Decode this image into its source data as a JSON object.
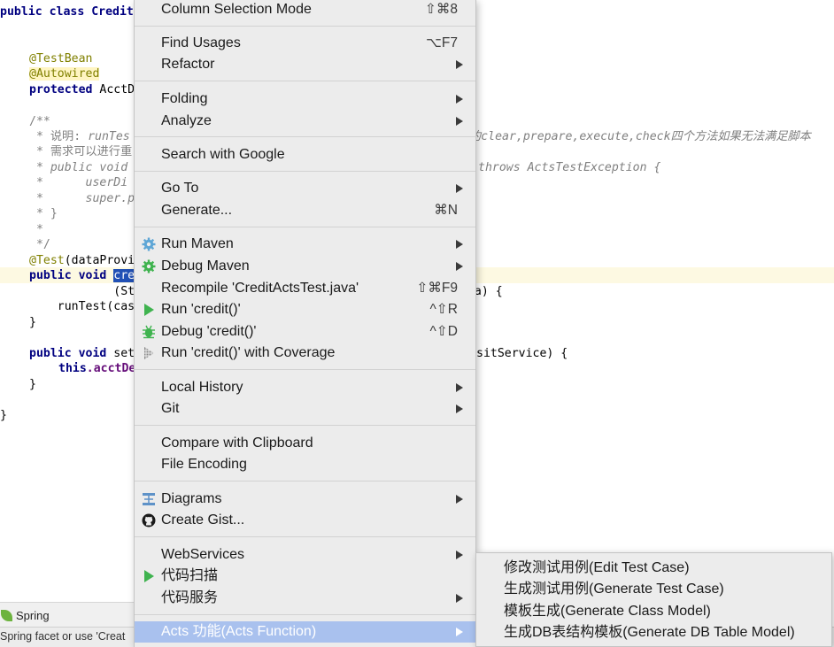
{
  "editor": {
    "lines": {
      "l0": "public class Credit",
      "l3": "@TestBean",
      "l4": "@Autowired",
      "l5_kw": "protected",
      "l5_rest": " AcctD",
      "l7": "/**",
      "l8_a": " * 说明: ",
      "l8_b": "runTes",
      "l8_right": "约clear,prepare,execute,check四个方法如果无法满足脚本",
      "l9": " * 需求可以进行重",
      "l10_a": " * public void",
      "l10_right": "throws ActsTestException {",
      "l11": " *      userDi",
      "l12": " *      super.p",
      "l13": " * }",
      "l14": " *",
      "l15": " */",
      "l16_ann": "@Test",
      "l16_rest": "(dataProvi",
      "l17_kw": "public void ",
      "l17_sel": "cre",
      "l18": "            (St",
      "l18_right": "ata) {",
      "l19": "    runTest(cas",
      "l20": "}",
      "l22_kw": "public void ",
      "l22_rest": "set",
      "l22_right": "sitService) {",
      "l23_kw": "this",
      "l23_rest": ".acctDe",
      "l24": "}",
      "l26": "}"
    }
  },
  "bottom": {
    "spring_tab": "Spring",
    "status": "Spring facet or use 'Creat"
  },
  "menu": {
    "column_selection": {
      "label": "Column Selection Mode",
      "shortcut": "⇧⌘8"
    },
    "find_usages": {
      "label": "Find Usages",
      "shortcut": "⌥F7"
    },
    "refactor": {
      "label": "Refactor"
    },
    "folding": {
      "label": "Folding"
    },
    "analyze": {
      "label": "Analyze"
    },
    "search_google": {
      "label": "Search with Google"
    },
    "go_to": {
      "label": "Go To"
    },
    "generate": {
      "label": "Generate...",
      "shortcut": "⌘N"
    },
    "run_maven": {
      "label": "Run Maven",
      "icon": "gear-icon"
    },
    "debug_maven": {
      "label": "Debug Maven",
      "icon": "gear-icon"
    },
    "recompile": {
      "label": "Recompile 'CreditActsTest.java'",
      "shortcut": "⇧⌘F9"
    },
    "run_credit": {
      "label": "Run 'credit()'",
      "shortcut": "^⇧R",
      "icon": "play-icon"
    },
    "debug_credit": {
      "label": "Debug 'credit()'",
      "shortcut": "^⇧D",
      "icon": "bug-icon"
    },
    "run_coverage": {
      "label": "Run 'credit()' with Coverage",
      "icon": "coverage-icon"
    },
    "local_history": {
      "label": "Local History"
    },
    "git": {
      "label": "Git"
    },
    "compare_clipboard": {
      "label": "Compare with Clipboard"
    },
    "file_encoding": {
      "label": "File Encoding"
    },
    "diagrams": {
      "label": "Diagrams",
      "icon": "diagram-icon"
    },
    "create_gist": {
      "label": "Create Gist...",
      "icon": "github-icon"
    },
    "webservices": {
      "label": "WebServices"
    },
    "code_scan": {
      "label": "代码扫描",
      "icon": "play-icon"
    },
    "code_service": {
      "label": "代码服务"
    },
    "acts_function": {
      "label": "Acts 功能(Acts Function)"
    }
  },
  "submenu": {
    "items": [
      "修改测试用例(Edit Test Case)",
      "生成测试用例(Generate Test Case)",
      "模板生成(Generate Class Model)",
      "生成DB表结构模板(Generate DB Table Model)"
    ]
  },
  "colors": {
    "menu_bg": "#ececec",
    "menu_highlight": "#a9c1ee",
    "play_green": "#3fb34f",
    "maven_gear": "#5ea6d6",
    "keyword": "#000080",
    "annotation": "#808000"
  }
}
